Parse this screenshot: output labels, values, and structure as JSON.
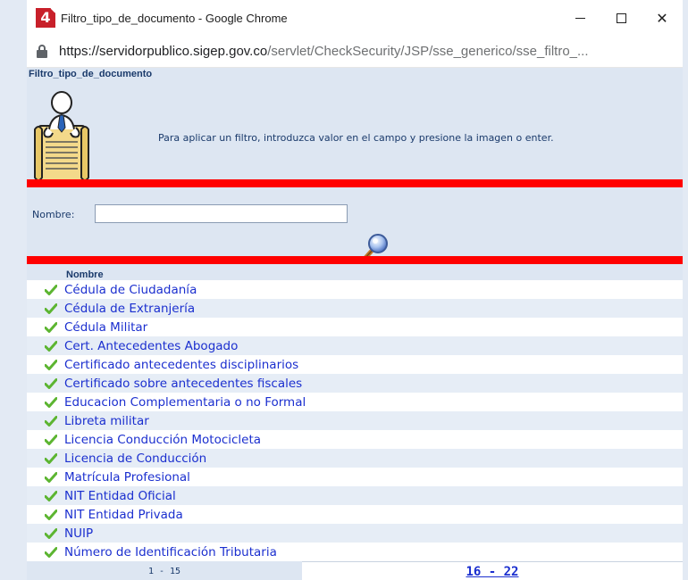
{
  "window": {
    "title": "Filtro_tipo_de_documento - Google Chrome",
    "app_icon_text": "4",
    "close_label": "✕"
  },
  "address": {
    "host": "https://servidorpublico.sigep.gov.co",
    "path": "/servlet/CheckSecurity/JSP/sse_generico/sse_filtro_..."
  },
  "page": {
    "section_title": "Filtro_tipo_de_documento",
    "instructions": "Para aplicar un filtro, introduzca valor en el campo y presione la imagen o enter."
  },
  "filter": {
    "label": "Nombre:",
    "value": ""
  },
  "list": {
    "header": "Nombre",
    "items": [
      {
        "label": "Cédula de Ciudadanía"
      },
      {
        "label": "Cédula de Extranjería"
      },
      {
        "label": "Cédula Militar"
      },
      {
        "label": "Cert. Antecedentes Abogado"
      },
      {
        "label": "Certificado antecedentes disciplinarios"
      },
      {
        "label": "Certificado sobre antecedentes fiscales"
      },
      {
        "label": "Educacion Complementaria o no Formal"
      },
      {
        "label": "Libreta militar"
      },
      {
        "label": "Licencia Conducción Motocicleta"
      },
      {
        "label": "Licencia de Conducción"
      },
      {
        "label": "Matrícula Profesional"
      },
      {
        "label": "NIT Entidad Oficial"
      },
      {
        "label": "NIT Entidad Privada"
      },
      {
        "label": "NUIP"
      },
      {
        "label": "Número de Identificación Tributaria"
      }
    ]
  },
  "pagination": {
    "current": "1 - 15",
    "next": "16 - 22"
  },
  "colors": {
    "link": "#1b2fcf",
    "panel_bg": "#dde6f2",
    "highlight_frame": "#ff0000",
    "check": "#5cb531"
  }
}
